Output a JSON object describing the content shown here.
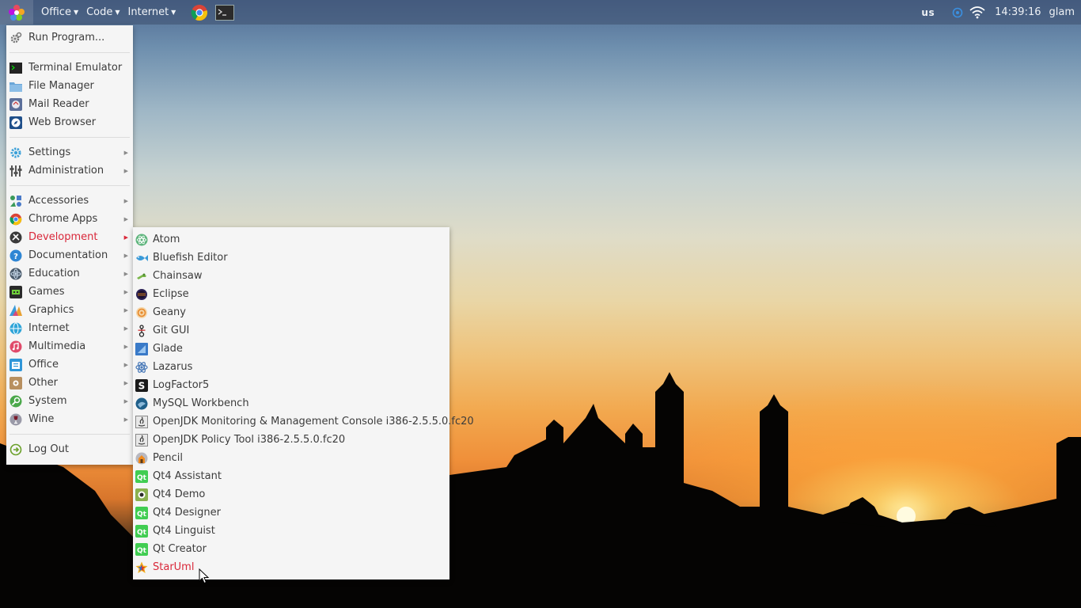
{
  "panel": {
    "logo_icon": "multicolor-flower-icon",
    "menus": [
      {
        "label": "Office"
      },
      {
        "label": "Code"
      },
      {
        "label": "Internet"
      }
    ],
    "launchers": [
      {
        "icon": "chrome-icon"
      },
      {
        "icon": "terminal-icon"
      }
    ],
    "keyboard_layout": "us",
    "clock": "14:39:16",
    "user": "glam"
  },
  "main_menu": {
    "groups": [
      [
        {
          "label": "Run Program...",
          "icon": "gear-icon"
        }
      ],
      [
        {
          "label": "Terminal Emulator",
          "icon": "terminal-icon"
        },
        {
          "label": "File Manager",
          "icon": "folder-icon"
        },
        {
          "label": "Mail Reader",
          "icon": "mail-icon"
        },
        {
          "label": "Web Browser",
          "icon": "compass-icon"
        }
      ],
      [
        {
          "label": "Settings",
          "icon": "gear-icon",
          "submenu": true
        },
        {
          "label": "Administration",
          "icon": "sliders-icon",
          "submenu": true
        }
      ],
      [
        {
          "label": "Accessories",
          "icon": "accessories-icon",
          "submenu": true
        },
        {
          "label": "Chrome Apps",
          "icon": "chrome-icon",
          "submenu": true
        },
        {
          "label": "Development",
          "icon": "development-icon",
          "submenu": true,
          "active": true
        },
        {
          "label": "Documentation",
          "icon": "help-icon",
          "submenu": true
        },
        {
          "label": "Education",
          "icon": "education-icon",
          "submenu": true
        },
        {
          "label": "Games",
          "icon": "games-icon",
          "submenu": true
        },
        {
          "label": "Graphics",
          "icon": "graphics-icon",
          "submenu": true
        },
        {
          "label": "Internet",
          "icon": "globe-icon",
          "submenu": true
        },
        {
          "label": "Multimedia",
          "icon": "music-icon",
          "submenu": true
        },
        {
          "label": "Office",
          "icon": "office-icon",
          "submenu": true
        },
        {
          "label": "Other",
          "icon": "other-icon",
          "submenu": true
        },
        {
          "label": "System",
          "icon": "system-icon",
          "submenu": true
        },
        {
          "label": "Wine",
          "icon": "wine-icon",
          "submenu": true
        }
      ],
      [
        {
          "label": "Log Out",
          "icon": "logout-icon"
        }
      ]
    ]
  },
  "development_menu": {
    "items": [
      {
        "label": "Atom",
        "icon": "atom-icon"
      },
      {
        "label": "Bluefish Editor",
        "icon": "bluefish-icon"
      },
      {
        "label": "Chainsaw",
        "icon": "chainsaw-icon"
      },
      {
        "label": "Eclipse",
        "icon": "eclipse-icon"
      },
      {
        "label": "Geany",
        "icon": "geany-icon"
      },
      {
        "label": "Git GUI",
        "icon": "git-icon"
      },
      {
        "label": "Glade",
        "icon": "glade-icon"
      },
      {
        "label": "Lazarus",
        "icon": "lazarus-icon"
      },
      {
        "label": "LogFactor5",
        "icon": "logfactor5-icon"
      },
      {
        "label": "MySQL Workbench",
        "icon": "mysql-workbench-icon"
      },
      {
        "label": "OpenJDK Monitoring & Management Console i386-2.5.5.0.fc20",
        "icon": "java-icon"
      },
      {
        "label": "OpenJDK Policy Tool i386-2.5.5.0.fc20",
        "icon": "java-icon"
      },
      {
        "label": "Pencil",
        "icon": "pencil-icon"
      },
      {
        "label": "Qt4 Assistant",
        "icon": "qt-icon"
      },
      {
        "label": "Qt4 Demo",
        "icon": "qt-demo-icon"
      },
      {
        "label": "Qt4 Designer",
        "icon": "qt-icon"
      },
      {
        "label": "Qt4 Linguist",
        "icon": "qt-icon"
      },
      {
        "label": "Qt Creator",
        "icon": "qt-icon"
      },
      {
        "label": "StarUml",
        "icon": "staruml-icon",
        "active": true
      }
    ]
  },
  "colors": {
    "accent_active": "#d9283a",
    "menu_bg": "#f5f5f5",
    "menu_text": "#3c3c3c"
  }
}
